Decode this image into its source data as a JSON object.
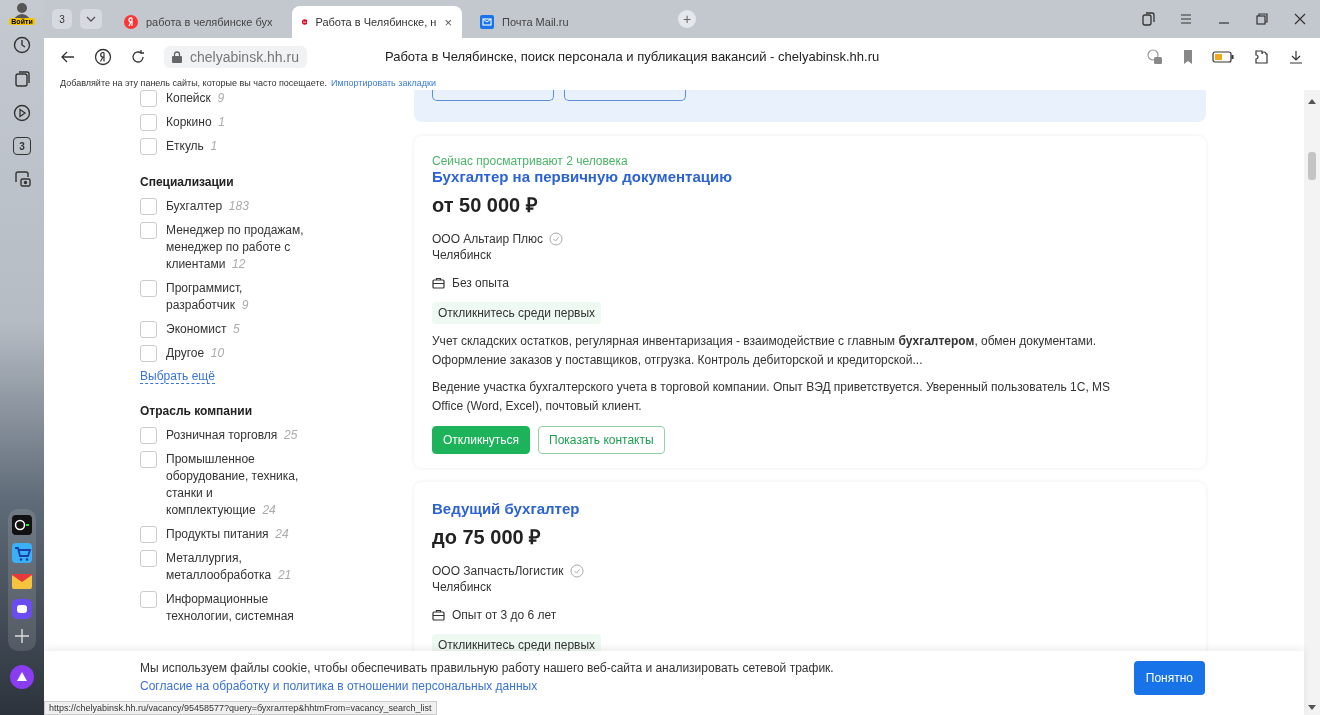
{
  "browser": {
    "login": "Войти",
    "tab_count": "3",
    "tabs": [
      {
        "title": "работа в челябинске бух",
        "selected": false
      },
      {
        "title": "Работа в Челябинске, н",
        "selected": true,
        "close": "×"
      },
      {
        "title": "Почта Mail.ru",
        "selected": false
      }
    ],
    "new_tab": "+",
    "address": "chelyabinsk.hh.ru",
    "page_title": "Работа в Челябинске, поиск персонала и публикация вакансий - chelyabinsk.hh.ru",
    "bookmarks_hint": "Добавляйте на эту панель сайты, которые вы часто посещаете.",
    "bookmarks_link": "Импортировать закладки",
    "sidebar_counter": "3",
    "status_url": "https://chelyabinsk.hh.ru/vacancy/95458577?query=бухгалтер&hhtmFrom=vacancy_search_list"
  },
  "filters": [
    {
      "items": [
        {
          "label": "Копейск",
          "count": "9",
          "checked": false
        },
        {
          "label": "Коркино",
          "count": "1",
          "checked": false
        },
        {
          "label": "Еткуль",
          "count": "1",
          "checked": false
        }
      ]
    },
    {
      "heading": "Специализации",
      "items": [
        {
          "label": "Бухгалтер",
          "count": "183",
          "checked": false
        },
        {
          "label": "Менеджер по продажам, менеджер по работе с клиентами",
          "count": "12",
          "checked": false
        },
        {
          "label": "Программист, разработчик",
          "count": "9",
          "checked": false
        },
        {
          "label": "Экономист",
          "count": "5",
          "checked": false
        },
        {
          "label": "Другое",
          "count": "10",
          "checked": false
        }
      ],
      "more": "Выбрать ещё"
    },
    {
      "heading": "Отрасль компании",
      "items": [
        {
          "label": "Розничная торговля",
          "count": "25",
          "checked": false
        },
        {
          "label": "Промышленное оборудование, техника, станки и комплектующие",
          "count": "24",
          "checked": false
        },
        {
          "label": "Продукты питания",
          "count": "24",
          "checked": false
        },
        {
          "label": "Металлургия, металлообработка",
          "count": "21",
          "checked": false
        },
        {
          "label": "Информационные технологии, системная",
          "checked": false
        }
      ]
    }
  ],
  "vacancies": [
    {
      "viewers": "Сейчас просматривают 2 человека",
      "title": "Бухгалтер на первичную документацию",
      "salary": "от 50 000 ₽",
      "company": "ООО Альтаир Плюс",
      "verified": true,
      "city": "Челябинск",
      "experience": "Без опыта",
      "badge": "Откликнитесь среди первых",
      "snippets": [
        "Учет складских остатков, регулярная инвентаризация - взаимодействие с главным **бухгалтером**, обмен документами. Оформление заказов у поставщиков, отгрузка. Контроль дебиторской и кредиторской...",
        "Ведение участка бухгалтерского учета в торговой компании. Опыт ВЭД приветствуется. Уверенный пользователь 1С, MS Office (Word, Excel), почтовый клиент."
      ],
      "actions": [
        {
          "label": "Откликнуться",
          "kind": "primary"
        },
        {
          "label": "Показать контакты",
          "kind": "outline"
        }
      ]
    },
    {
      "title": "Ведущий бухгалтер",
      "salary": "до 75 000 ₽",
      "company": "ООО ЗапчастьЛогистик",
      "verified": true,
      "city": "Челябинск",
      "experience": "Опыт от 3 до 6 лет",
      "badge": "Откликнитесь среди первых"
    }
  ],
  "cookie": {
    "text": "Мы используем файлы cookie, чтобы обеспечивать правильную работу нашего веб-сайта и анализировать сетевой трафик.",
    "link": "Согласие на обработку и политика в отношении персональных данных",
    "button": "Понятно"
  }
}
